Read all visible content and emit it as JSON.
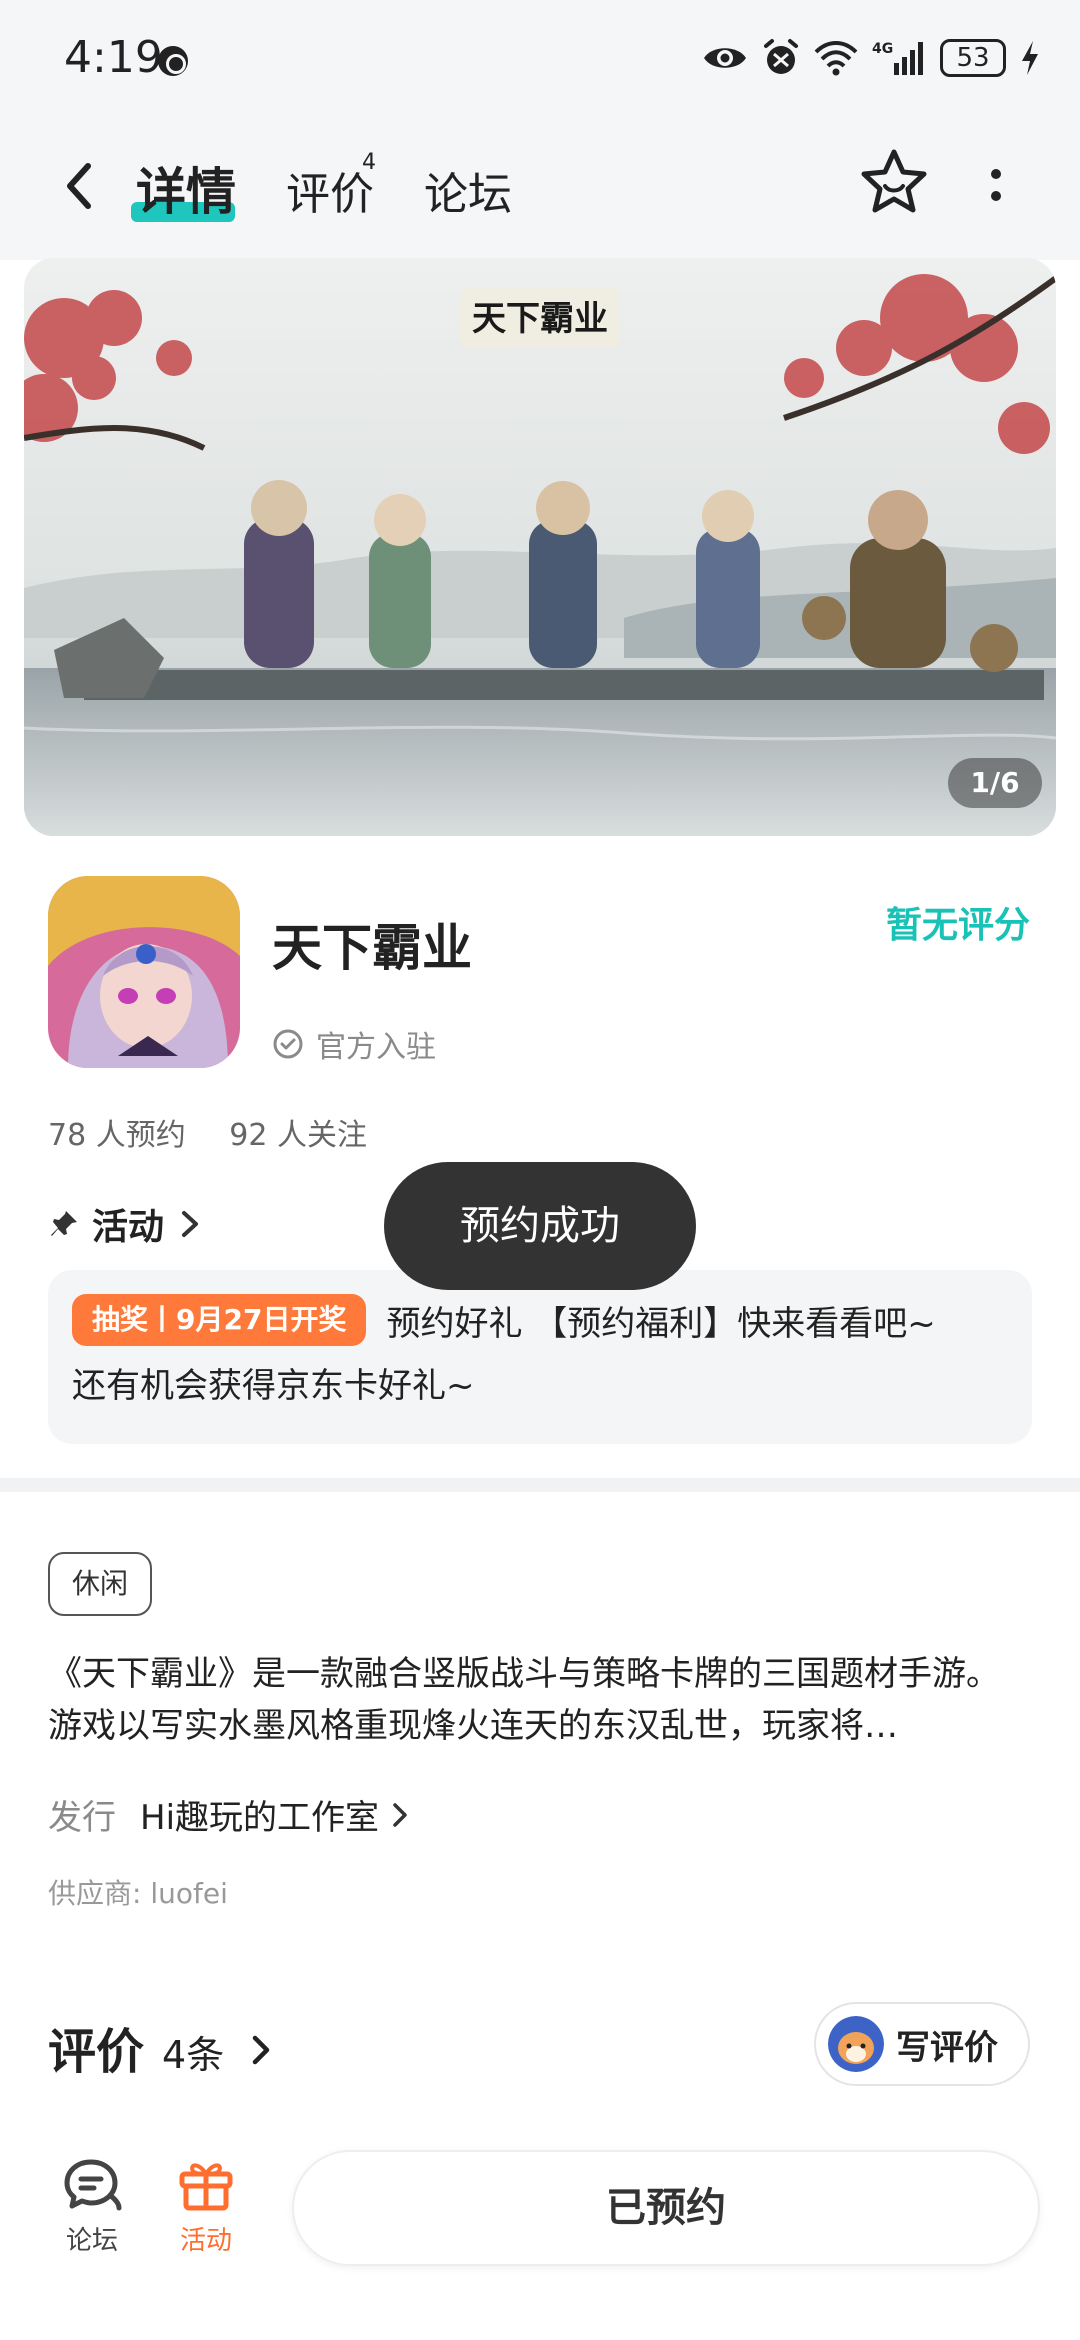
{
  "status_bar": {
    "time": "4:19",
    "network": "4G",
    "battery": "53"
  },
  "nav": {
    "tabs": [
      {
        "label": "详情",
        "active": true
      },
      {
        "label": "评价",
        "badge": "4"
      },
      {
        "label": "论坛"
      }
    ]
  },
  "banner": {
    "counter": "1/6"
  },
  "app": {
    "name": "天下霸业",
    "verified_label": "官方入驻",
    "rating_text": "暂无评分",
    "reservations": "78 人预约",
    "followers": "92 人关注"
  },
  "activity": {
    "heading": "活动",
    "badge": "抽奖丨9月27日开奖",
    "line1": "预约好礼 【预约福利】快来看看吧~",
    "line2": "还有机会获得京东卡好礼~"
  },
  "toast": "预约成功",
  "details": {
    "tag": "休闲",
    "description": "《天下霸业》是一款融合竖版战斗与策略卡牌的三国题材手游。游戏以写实水墨风格重现烽火连天的东汉乱世，玩家将…",
    "publisher_label": "发行",
    "publisher_name": "Hi趣玩的工作室",
    "supplier": "供应商: luofei"
  },
  "reviews": {
    "title": "评价",
    "count": "4条",
    "write_label": "写评价"
  },
  "bottom_bar": {
    "forum_label": "论坛",
    "activity_label": "活动",
    "reserved_label": "已预约"
  },
  "colors": {
    "accent_teal": "#1ec6bd",
    "accent_orange": "#ff7a3a",
    "activity_orange": "#ff6e2e"
  },
  "icons": [
    "eye-icon",
    "alarm-icon",
    "wifi-icon",
    "signal-icon",
    "charging-icon",
    "back-icon",
    "star-icon",
    "more-icon",
    "verified-icon",
    "pin-icon",
    "chevron-right-icon",
    "forum-icon",
    "gift-icon"
  ]
}
